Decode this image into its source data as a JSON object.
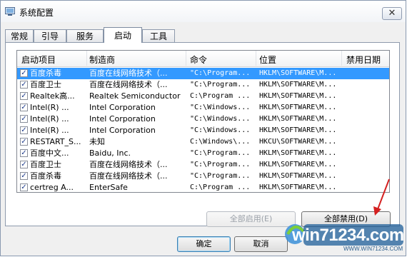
{
  "window": {
    "title": "系统配置",
    "close_label": "✕"
  },
  "tabs": [
    {
      "label": "常规",
      "active": false
    },
    {
      "label": "引导",
      "active": false
    },
    {
      "label": "服务",
      "active": false
    },
    {
      "label": "启动",
      "active": true
    },
    {
      "label": "工具",
      "active": false
    }
  ],
  "table": {
    "headers": [
      "启动项目",
      "制造商",
      "命令",
      "位置",
      "禁用日期"
    ],
    "rows": [
      {
        "item": "百度杀毒",
        "maker": "百度在线网络技术（...",
        "cmd": "\"C:\\Program...",
        "loc": "HKLM\\SOFTWARE\\M...",
        "date": "",
        "checked": true,
        "selected": true
      },
      {
        "item": "百度卫士",
        "maker": "百度在线网络技术（...",
        "cmd": "\"C:\\Program...",
        "loc": "HKLM\\SOFTWARE\\M...",
        "date": "",
        "checked": true,
        "selected": false
      },
      {
        "item": "Realtek高...",
        "maker": "Realtek Semiconductor",
        "cmd": "C:\\Program ...",
        "loc": "HKLM\\SOFTWARE\\M...",
        "date": "",
        "checked": true,
        "selected": false
      },
      {
        "item": "Intel(R) ...",
        "maker": "Intel Corporation",
        "cmd": "\"C:\\Windows...",
        "loc": "HKLM\\SOFTWARE\\M...",
        "date": "",
        "checked": true,
        "selected": false
      },
      {
        "item": "Intel(R) ...",
        "maker": "Intel Corporation",
        "cmd": "\"C:\\Windows...",
        "loc": "HKLM\\SOFTWARE\\M...",
        "date": "",
        "checked": true,
        "selected": false
      },
      {
        "item": "Intel(R) ...",
        "maker": "Intel Corporation",
        "cmd": "\"C:\\Windows...",
        "loc": "HKLM\\SOFTWARE\\M...",
        "date": "",
        "checked": true,
        "selected": false
      },
      {
        "item": "RESTART_S...",
        "maker": "未知",
        "cmd": "C:\\Windows\\...",
        "loc": "HKCU\\SOFTWARE\\M...",
        "date": "",
        "checked": true,
        "selected": false
      },
      {
        "item": "百度中文...",
        "maker": "Baidu, Inc.",
        "cmd": "\"C:\\Program...",
        "loc": "HKLM\\SOFTWARE\\M...",
        "date": "",
        "checked": true,
        "selected": false
      },
      {
        "item": "百度卫士",
        "maker": "百度在线网络技术（...",
        "cmd": "\"C:\\Program...",
        "loc": "HKLM\\SOFTWARE\\M...",
        "date": "",
        "checked": true,
        "selected": false
      },
      {
        "item": "百度杀毒",
        "maker": "百度在线网络技术（...",
        "cmd": "\"C:\\Program...",
        "loc": "HKLM\\SOFTWARE\\M...",
        "date": "",
        "checked": true,
        "selected": false
      },
      {
        "item": "certreg A...",
        "maker": "EnterSafe",
        "cmd": "C:\\Program ...",
        "loc": "HKLM\\SOFTWARE\\M...",
        "date": "",
        "checked": true,
        "selected": false
      }
    ]
  },
  "buttons": {
    "enable_all": "全部启用(E)",
    "disable_all": "全部禁用(D)",
    "ok": "确定",
    "cancel": "取消"
  },
  "watermark": {
    "text": "win71234.com",
    "url": "WWW.WIN71234.COM"
  },
  "colors": {
    "selection": "#3399ff",
    "accent_border": "#3c7fb1",
    "arrow": "#d42020"
  }
}
